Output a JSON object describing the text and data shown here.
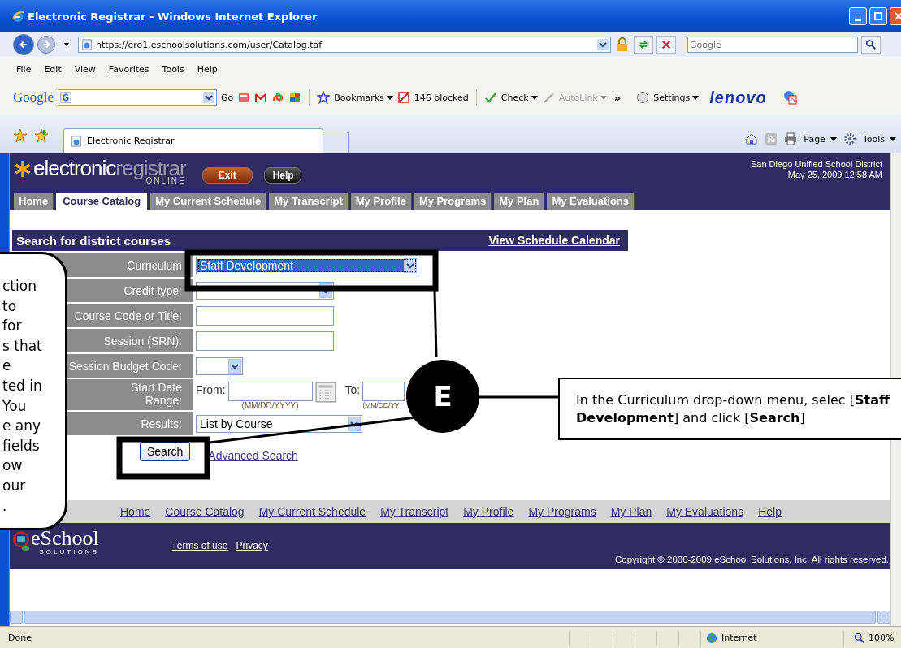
{
  "window": {
    "title": "Electronic Registrar - Windows Internet Explorer"
  },
  "address_bar": {
    "url": "https://ero1.eschoolsolutions.com/user/Catalog.taf"
  },
  "search_box": {
    "placeholder": "Google"
  },
  "menu": [
    "File",
    "Edit",
    "View",
    "Favorites",
    "Tools",
    "Help"
  ],
  "google_toolbar": {
    "logo": "Google",
    "go": "Go",
    "bookmarks": "Bookmarks",
    "blocked": "146 blocked",
    "check": "Check",
    "autolink": {
      "label": "AutoLink",
      "disabled": true
    },
    "more": "»",
    "settings": "Settings",
    "brand": "lenovo"
  },
  "browser_tab": {
    "title": "Electronic Registrar",
    "selected": true
  },
  "command_bar": {
    "page": "Page",
    "tools": "Tools"
  },
  "site_header": {
    "logo_light": "electronic",
    "logo_dark": "registrar",
    "logo_sub": "ONLINE",
    "buttons": [
      {
        "label": "Exit",
        "kind": "accent"
      },
      {
        "label": "Help",
        "kind": "plain"
      }
    ],
    "district": "San Diego Unified School District",
    "datetime": "May 25, 2009 12:58 AM"
  },
  "nav_tabs": [
    {
      "label": "Home",
      "selected": false
    },
    {
      "label": "Course Catalog",
      "selected": true
    },
    {
      "label": "My Current Schedule",
      "selected": false
    },
    {
      "label": "My Transcript",
      "selected": false
    },
    {
      "label": "My Profile",
      "selected": false
    },
    {
      "label": "My Programs",
      "selected": false
    },
    {
      "label": "My Plan",
      "selected": false
    },
    {
      "label": "My Evaluations",
      "selected": false
    }
  ],
  "search_panel": {
    "title": "Search for district courses",
    "calendar_link": "View Schedule Calendar"
  },
  "form": {
    "rows": [
      {
        "label": "Curriculum",
        "kind": "wide_select",
        "value": "Staff Development",
        "focused": true
      },
      {
        "label": "Credit type:",
        "kind": "select",
        "focused": false
      },
      {
        "label": "Course Code or Title:",
        "kind": "text",
        "focused": false
      },
      {
        "label": "Session (SRN):",
        "kind": "text",
        "focused": false
      },
      {
        "label": "Session Budget Code:",
        "kind": "short_select",
        "focused": false
      },
      {
        "label": "Start Date Range:",
        "kind": "date_range",
        "from_label": "From:",
        "to_label": "To:",
        "hint": "(MM/DD/YYYY)",
        "to_hint": "(MM/DD/YY",
        "focused": false
      },
      {
        "label": "Results:",
        "kind": "medium_select",
        "value": "List by Course",
        "focused": false
      }
    ],
    "search_button": "Search",
    "advanced_link": "Advanced Search"
  },
  "footer_links": [
    "Home",
    "Course Catalog",
    "My Current Schedule",
    "My Transcript",
    "My Profile",
    "My Programs",
    "My Plan",
    "My Evaluations",
    "Help"
  ],
  "footer": {
    "logo": "eSchool",
    "logo_sub": "SOLUTIONS",
    "links": [
      "Terms of use",
      "Privacy"
    ],
    "copyright": "Copyright © 2000-2009 eSchool Solutions, Inc. All rights reserved."
  },
  "status_bar": {
    "status": "Done",
    "zone": "Internet",
    "zoom": "100%"
  },
  "callout_left": {
    "lines": [
      "ction",
      "to",
      "for",
      "s that",
      "e",
      "ted in",
      "You",
      "e any",
      "fields",
      "ow",
      "our",
      "."
    ]
  },
  "callout_right": {
    "text": "In the Curriculum drop-down menu, selec [**Staff Development**] and click [**Search**]"
  },
  "step_marker": "E"
}
